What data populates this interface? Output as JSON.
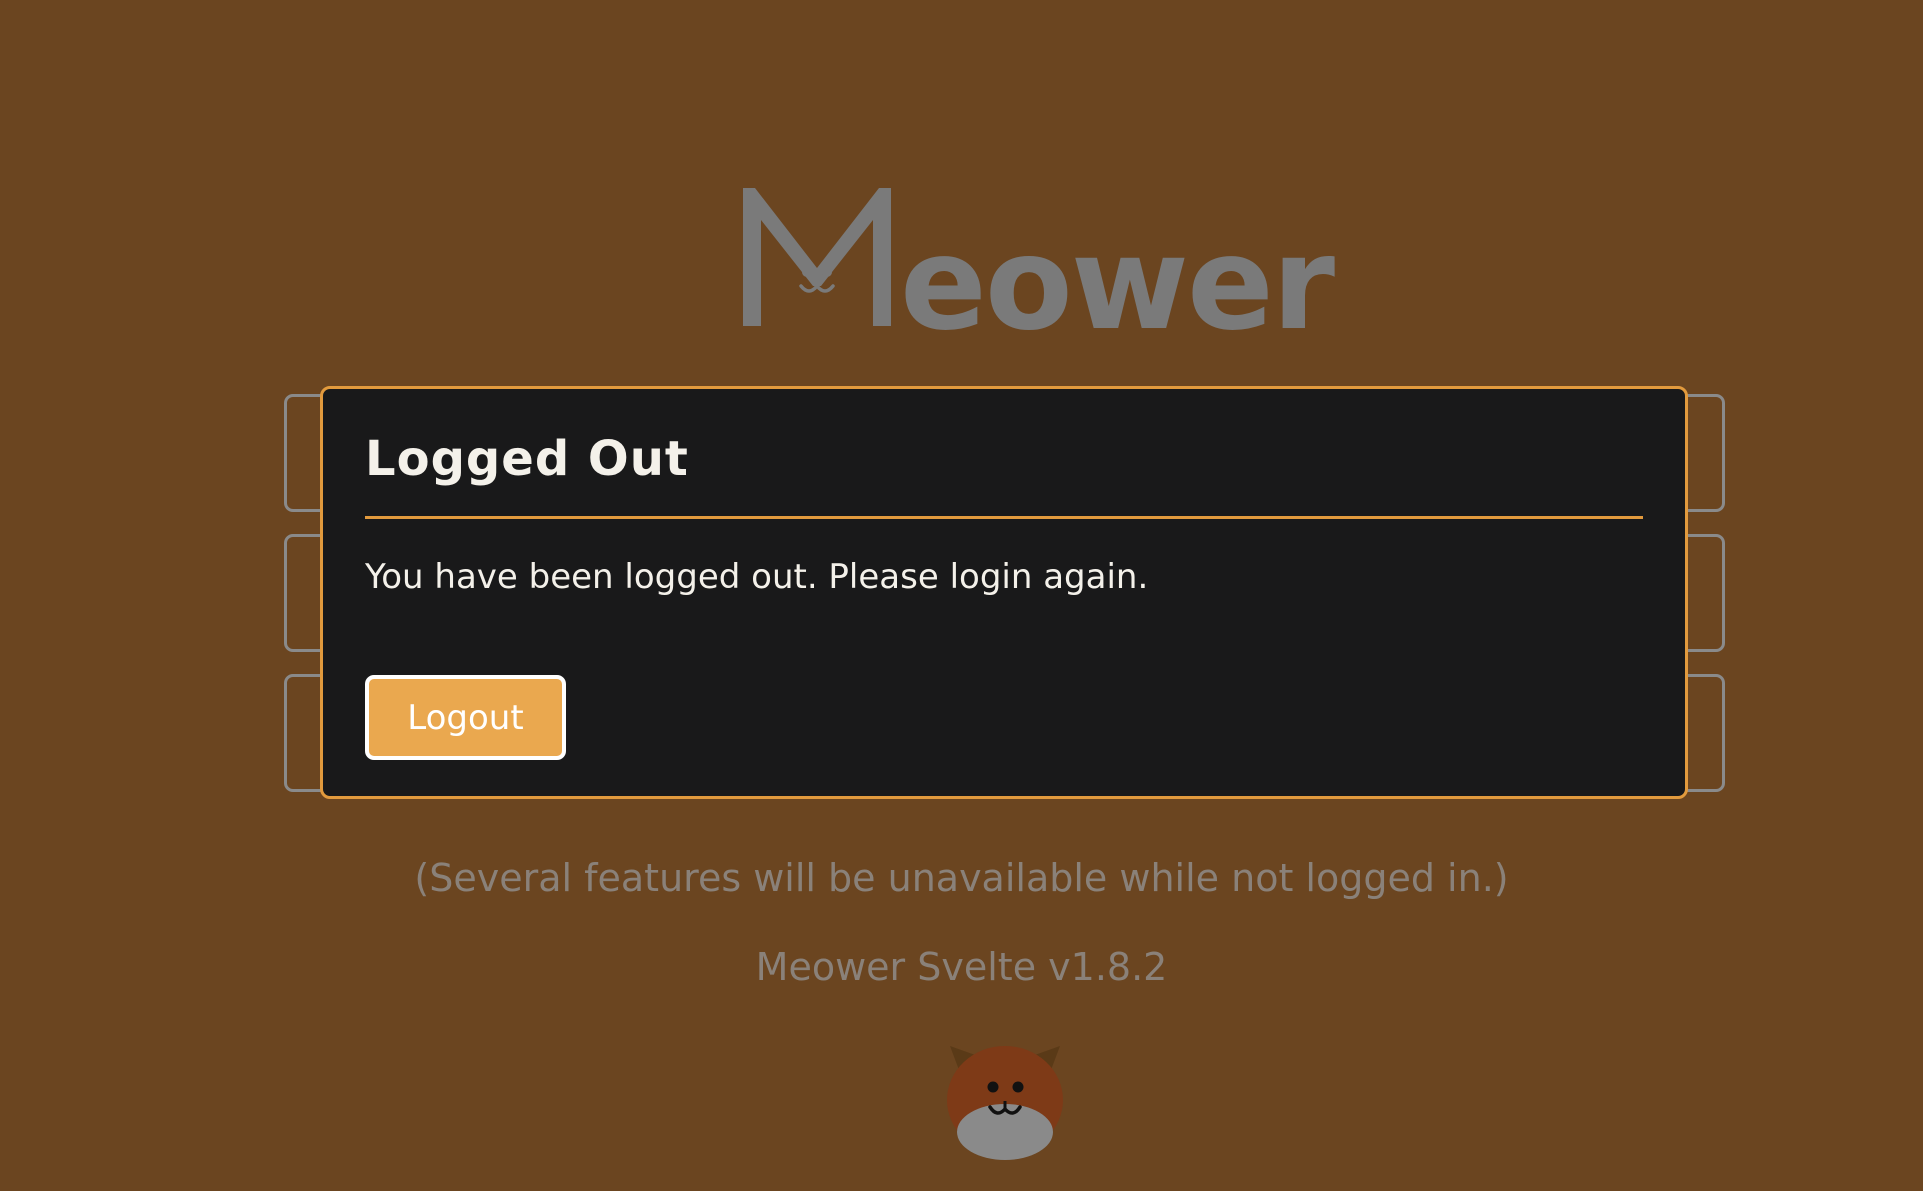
{
  "app": {
    "logo_text": "eower",
    "logo_alt": "Meower",
    "brand_color": "#7a7a7a",
    "background_color": "#6b4520"
  },
  "modal": {
    "title": "Logged Out",
    "message": "You have been logged out. Please login again.",
    "logout_button_label": "Logout",
    "accent_color": "#e29a3d",
    "button_color": "#eaa84f"
  },
  "footer": {
    "notice": "(Several features will be unavailable while not logged in.)",
    "version": "Meower Svelte v1.8.2"
  },
  "icons": {
    "logo_icon": "meower-cat-m-logo",
    "mascot_icon": "meower-cat-mascot"
  }
}
